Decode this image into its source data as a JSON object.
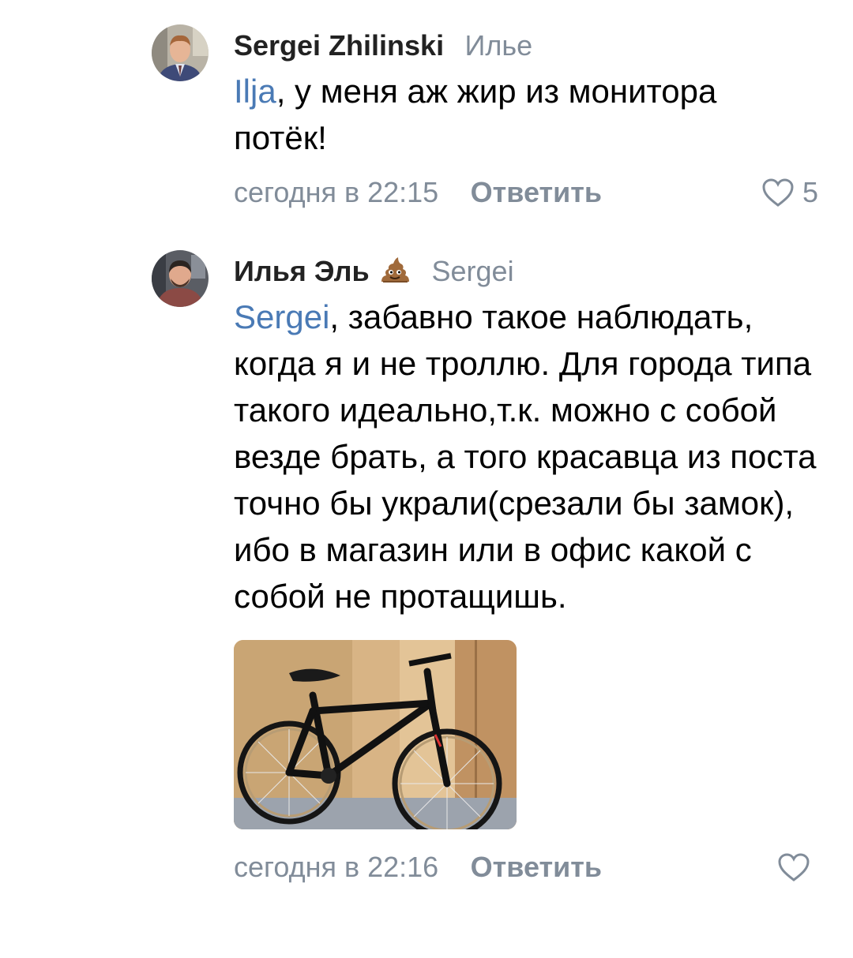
{
  "comments": [
    {
      "author": "Sergei Zhilinski",
      "reply_to": "Илье",
      "mention": "Ilja",
      "text": ", у меня аж жир из монитора потёк!",
      "date": "сегодня в 22:15",
      "reply_label": "Ответить",
      "likes": "5"
    },
    {
      "author": "Илья Эль",
      "author_emoji": "pile-of-poo-emoji",
      "reply_to": "Sergei",
      "mention": "Sergei",
      "text": ", забавно такое наблюдать, когда я и не троллю. Для города типа такого идеально,т.к. можно с собой везде брать, а того красавца из поста точно бы украли(срезали бы замок), ибо в магазин или в офис какой с собой не протащишь.",
      "date": "сегодня в 22:16",
      "reply_label": "Ответить",
      "likes": ""
    }
  ],
  "colors": {
    "mention": "#4a7ab5",
    "meta": "#818c99",
    "author": "#222222"
  },
  "icons": {
    "like": "heart-outline-icon"
  }
}
